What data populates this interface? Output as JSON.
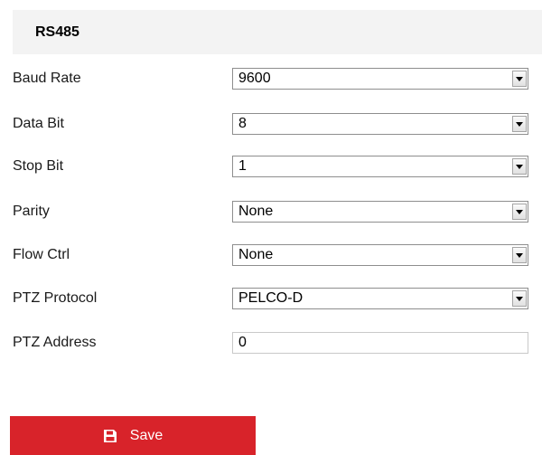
{
  "section": {
    "title": "RS485"
  },
  "fields": {
    "baud_rate": {
      "label": "Baud Rate",
      "value": "9600"
    },
    "data_bit": {
      "label": "Data Bit",
      "value": "8"
    },
    "stop_bit": {
      "label": "Stop Bit",
      "value": "1"
    },
    "parity": {
      "label": "Parity",
      "value": "None"
    },
    "flow_ctrl": {
      "label": "Flow Ctrl",
      "value": "None"
    },
    "ptz_protocol": {
      "label": "PTZ Protocol",
      "value": "PELCO-D"
    },
    "ptz_address": {
      "label": "PTZ Address",
      "value": "0"
    }
  },
  "actions": {
    "save_label": "Save",
    "save_icon": "floppy-disk-icon"
  },
  "colors": {
    "accent": "#d8232a",
    "header_bg": "#f3f3f3"
  }
}
